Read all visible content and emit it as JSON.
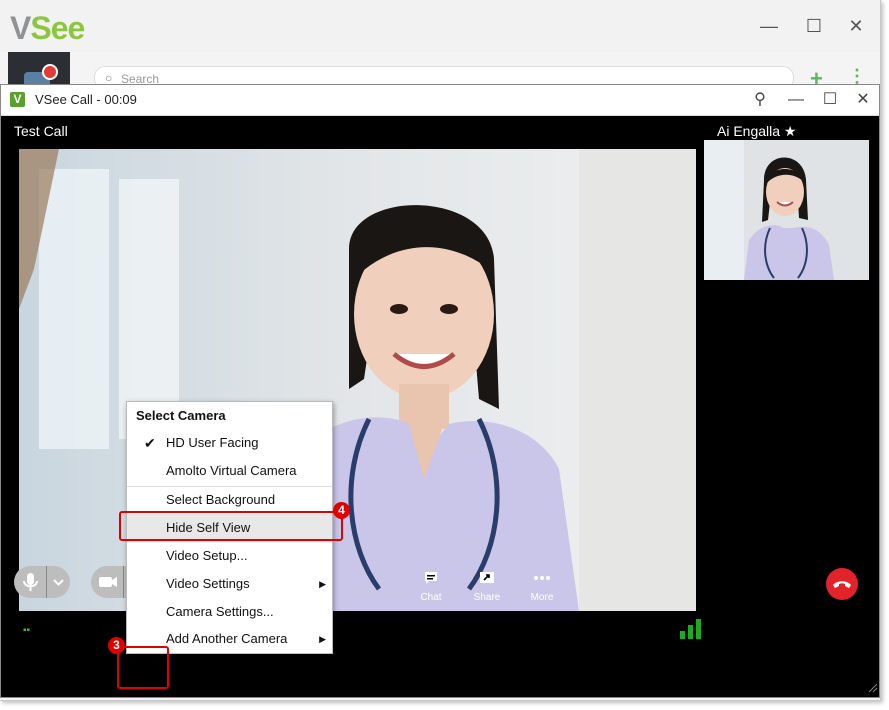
{
  "background_app": {
    "logo_v": "V",
    "logo_see": "See",
    "minimize": "—",
    "maximize": "☐",
    "close": "✕",
    "search_placeholder": "Search",
    "add": "+",
    "more": "⋮"
  },
  "call_window": {
    "logo": "V",
    "title": "VSee Call - 00:09",
    "pin": "⚲",
    "minimize": "—",
    "maximize": "☐",
    "close": "✕",
    "call_label": "Test Call",
    "remote_name": "Ai Engalla ★"
  },
  "status_dots": "▪▪",
  "toolbar": {
    "chat_label": "Chat",
    "share_label": "Share",
    "more_label": "More"
  },
  "camera_menu": {
    "heading": "Select Camera",
    "checkmark": "✔",
    "items": [
      {
        "label": "HD User Facing",
        "checked": true
      },
      {
        "label": "Amolto Virtual Camera"
      },
      {
        "label": "Select Background"
      },
      {
        "label": "Hide Self View",
        "highlighted": true
      },
      {
        "label": "Video Setup..."
      },
      {
        "label": "Video Settings",
        "submenu": true
      },
      {
        "label": "Camera Settings..."
      },
      {
        "label": "Add Another Camera",
        "submenu": true
      }
    ],
    "submenu_arrow": "▶"
  },
  "annotations": {
    "step3": "3",
    "step4": "4"
  },
  "colors": {
    "brand_green": "#8cc63f",
    "end_call_red": "#e3232a",
    "annotation_red": "#e00000"
  }
}
